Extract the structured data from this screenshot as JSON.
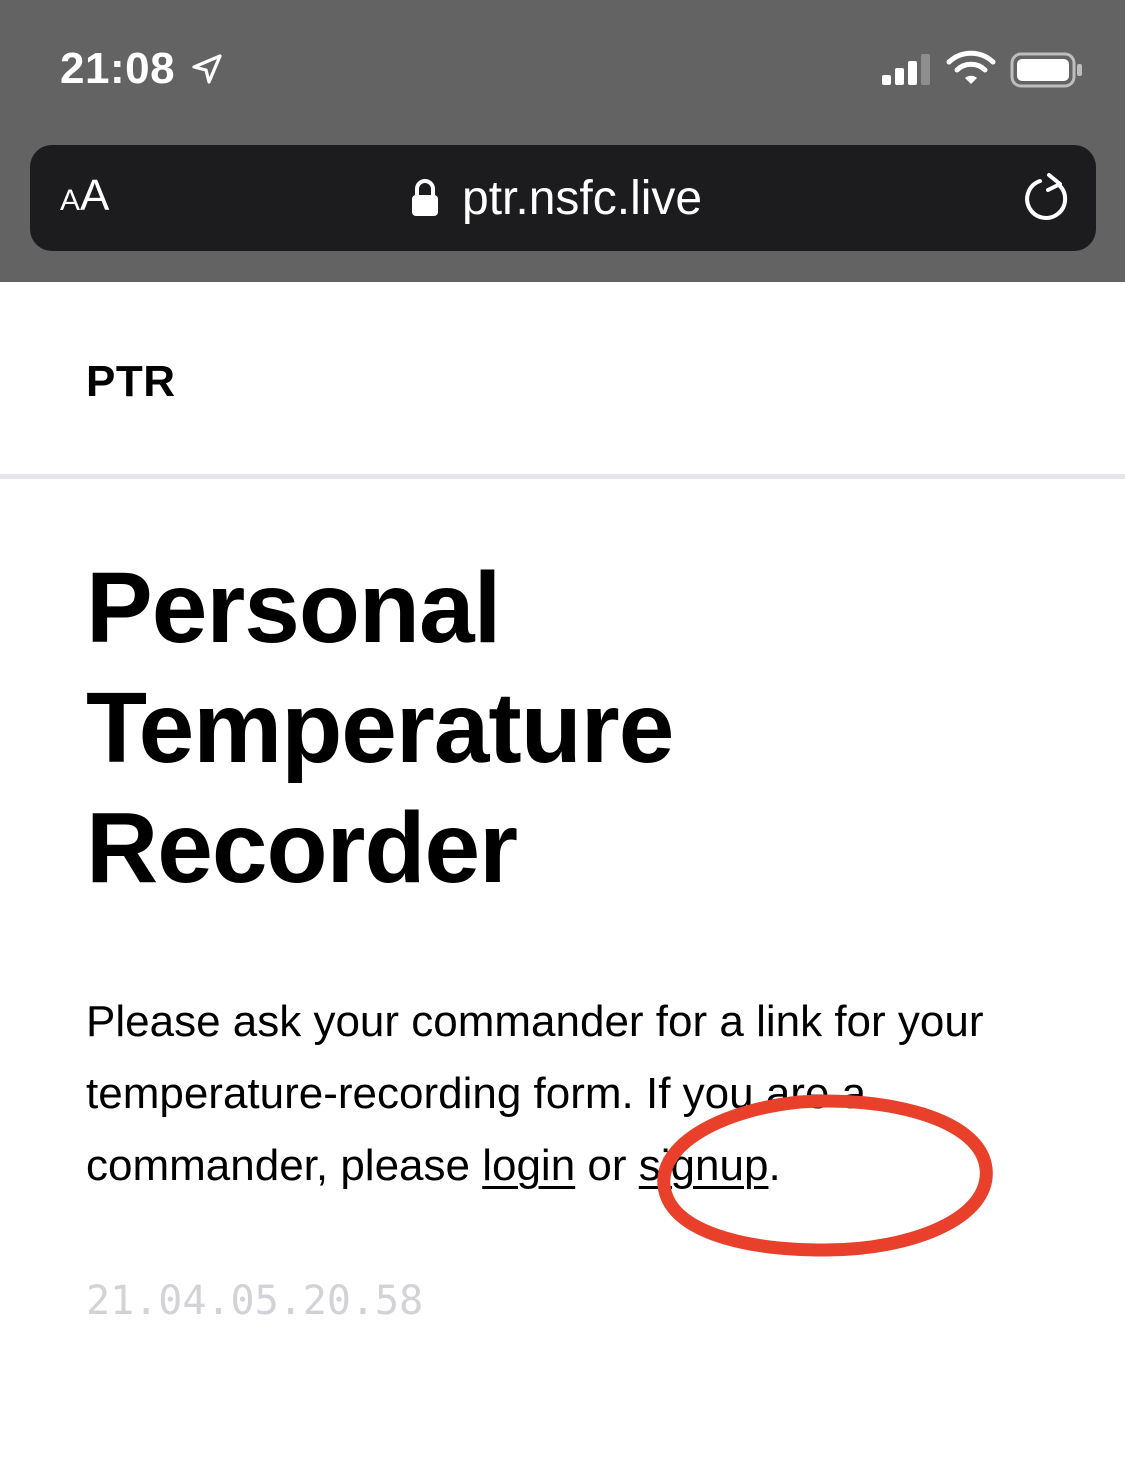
{
  "status_bar": {
    "time": "21:08",
    "icons": [
      "location-arrow-icon",
      "cellular-signal-icon",
      "wifi-icon",
      "battery-icon"
    ]
  },
  "browser": {
    "text_size_small": "A",
    "text_size_large": "A",
    "url": "ptr.nsfc.live",
    "icons": [
      "lock-icon",
      "reload-icon"
    ]
  },
  "site": {
    "brand": "PTR"
  },
  "main": {
    "title_lines": [
      "Personal",
      "Temperature",
      "Recorder"
    ],
    "intro_text": "Please ask your commander for a link for your temperature-recording form. If you are a commander, please ",
    "login_link": "login",
    "connector": " or ",
    "signup_link": "signup",
    "end_punct": ".",
    "version": "21.04.05.20.58"
  },
  "annotation": {
    "shape": "ellipse",
    "color": "#e8402b",
    "target": "signup"
  },
  "colors": {
    "chrome_bg": "#636363",
    "address_bar_bg": "#1c1c1e",
    "divider": "#e5e5ea",
    "version_text": "#d2d2d7"
  }
}
